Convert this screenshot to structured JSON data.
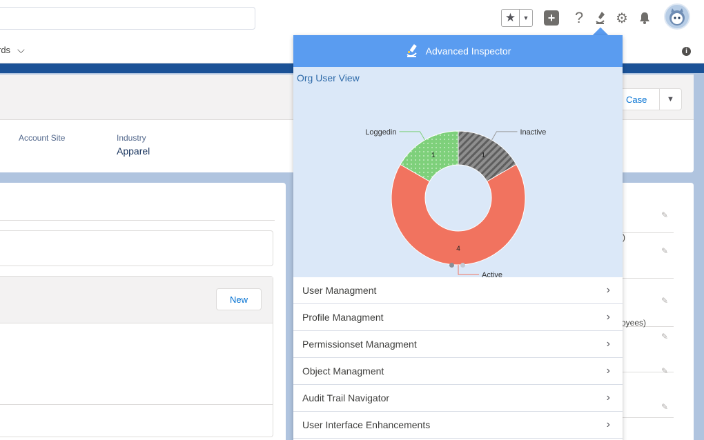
{
  "header": {
    "icons": [
      "star-icon",
      "caret-down-icon",
      "plus-icon",
      "help-icon",
      "inspector-icon",
      "gear-icon",
      "bell-icon"
    ]
  },
  "nav": {
    "partial_item": "rds"
  },
  "record": {
    "fields": [
      {
        "label": "Account Site",
        "value": ""
      },
      {
        "label": "Industry",
        "value": "Apparel"
      }
    ],
    "case_button": "Case"
  },
  "related": {
    "new_button": "New"
  },
  "right_fragments": [
    ")",
    "oyees)"
  ],
  "inspector": {
    "title": "Advanced Inspector",
    "chart_title": "Org User View",
    "menu": [
      "User Managment",
      "Profile Managment",
      "Permissionset Managment",
      "Object Managment",
      "Audit Trail Navigator",
      "User Interface Enhancements"
    ]
  },
  "chart_data": {
    "type": "pie",
    "variant": "donut",
    "title": "Org User View",
    "categories": [
      "Loggedin",
      "Inactive",
      "Active"
    ],
    "values": [
      1,
      1,
      4
    ],
    "colors": [
      "#7ed07b",
      "#9a9a9a",
      "#f1735f"
    ],
    "patterns": [
      "dots",
      "diagonal-stripes",
      "solid"
    ],
    "legend": "callout-labels"
  }
}
